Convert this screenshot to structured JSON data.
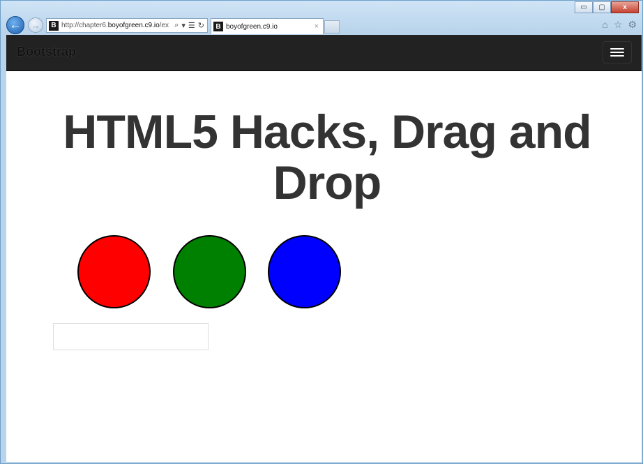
{
  "window": {
    "minimize_label": "▭",
    "maximize_label": "▢",
    "close_label": "x"
  },
  "browser": {
    "back_icon": "←",
    "forward_icon": "→",
    "favicon_letter": "B",
    "url_prefix": "http://chapter6.",
    "url_domain": "boyofgreen.c9.io",
    "url_suffix": "/ex",
    "tab_title": "boyofgreen.c9.io",
    "tab_close": "×",
    "address_icons": [
      "search-icon",
      "dropdown-icon",
      "compat-view-icon",
      "refresh-icon"
    ],
    "tool_icons": [
      "home-icon",
      "favorites-icon",
      "settings-icon"
    ]
  },
  "navbar": {
    "brand": "Bootstrap",
    "toggle_icon": "hamburger-icon"
  },
  "main": {
    "heading": "HTML5 Hacks, Drag and Drop",
    "circles": [
      {
        "name": "red",
        "color": "#ff0000"
      },
      {
        "name": "green",
        "color": "#008000"
      },
      {
        "name": "blue",
        "color": "#0000ff"
      }
    ]
  }
}
